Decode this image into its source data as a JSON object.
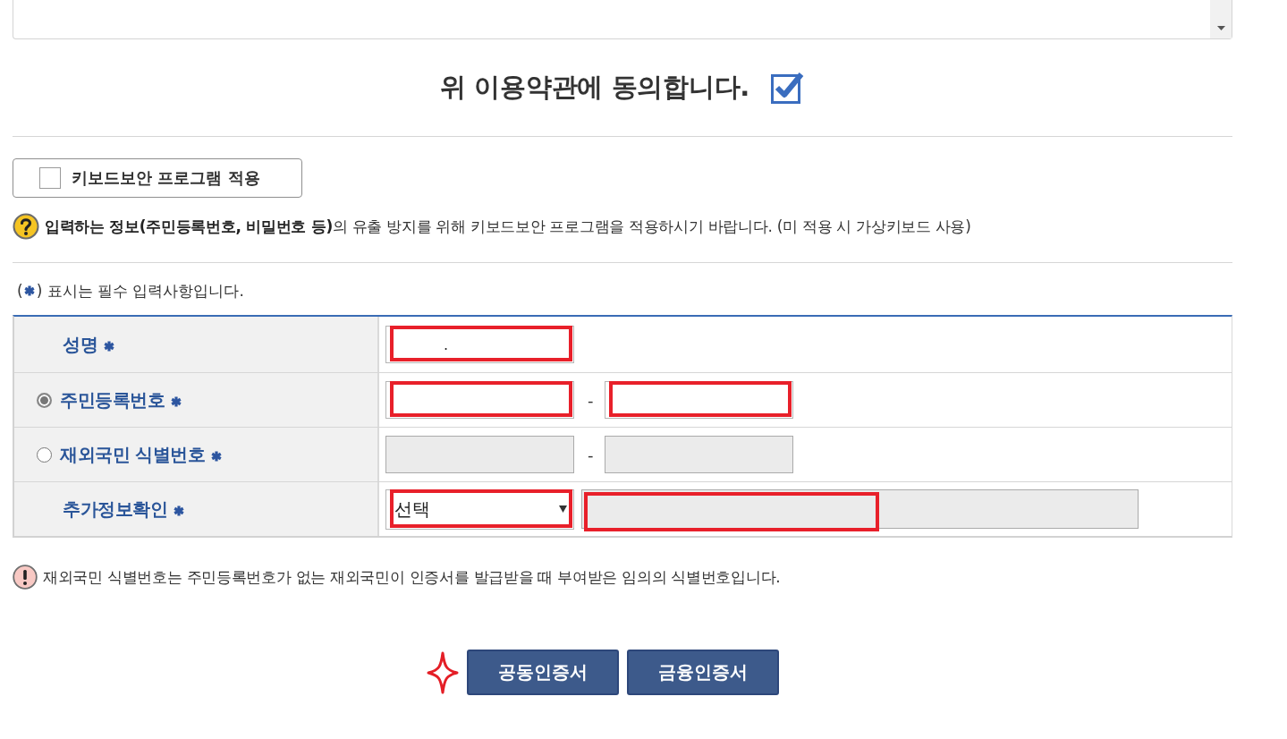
{
  "agreement": {
    "label": "위 이용약관에 동의합니다.",
    "checked": true
  },
  "keyboard_security": {
    "label": "키보드보안 프로그램 적용",
    "checked": false
  },
  "security_notice": "**입력하는 정보(주민등록번호, 비밀번호 등)**의 유출 방지를 위해 키보드보안 프로그램을 적용하시기 바랍니다. (미 적용 시 가상키보드 사용)",
  "required_note": {
    "open": "(",
    "text": ") 표시는 필수 입력사항입니다."
  },
  "form_rows": [
    {
      "kind": "text",
      "label": "성명",
      "required": true,
      "fields": [
        {
          "value": ".",
          "disabled": false,
          "highlighted": true
        }
      ]
    },
    {
      "kind": "radio",
      "label": "주민등록번호",
      "required": true,
      "selected": true,
      "separator": "-",
      "fields": [
        {
          "disabled": false,
          "highlighted": true
        },
        {
          "disabled": false,
          "highlighted": true
        }
      ]
    },
    {
      "kind": "radio",
      "label": "재외국민 식별번호",
      "required": true,
      "selected": false,
      "separator": "-",
      "fields": [
        {
          "disabled": true,
          "highlighted": false
        },
        {
          "disabled": true,
          "highlighted": false
        }
      ]
    },
    {
      "kind": "select",
      "label": "추가정보확인",
      "required": true,
      "select": {
        "value": "선택",
        "highlighted": true
      },
      "fields": [
        {
          "disabled": true,
          "highlighted": true
        }
      ]
    }
  ],
  "overseas_notice": "재외국민 식별번호는 주민등록번호가 없는 재외국민이 인증서를 발급받을 때 부여받은 임의의 식별번호입니다.",
  "buttons": [
    {
      "label": "공동인증서",
      "highlighted": true
    },
    {
      "label": "금융인증서",
      "highlighted": false
    }
  ]
}
